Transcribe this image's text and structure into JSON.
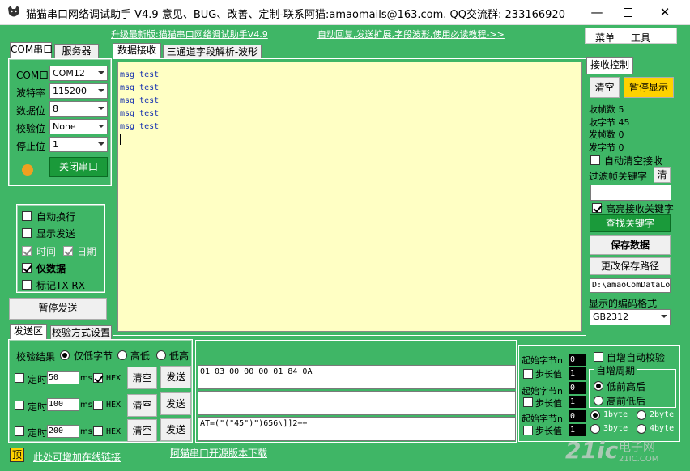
{
  "window": {
    "title": "猫猫串口网络调试助手 V4.9 意见、BUG、改善、定制-联系阿猫:amaomails@163.com. QQ交流群: 233166920"
  },
  "top_links": {
    "upgrade": "升级最新版:猫猫串口网络调试助手V4.9",
    "features": "自动回复,发送扩展,字段波形,使用必读教程->>"
  },
  "menu": {
    "items": [
      "菜单",
      "工具"
    ]
  },
  "left": {
    "tabs": [
      "COM串口",
      "服务器"
    ],
    "fields": [
      {
        "label": "COM口",
        "value": "COM12"
      },
      {
        "label": "波特率",
        "value": "115200"
      },
      {
        "label": "数据位",
        "value": "8"
      },
      {
        "label": "校验位",
        "value": "None"
      },
      {
        "label": "停止位",
        "value": "1"
      }
    ],
    "close_port": "关闭串口",
    "status_color": "#f0a020",
    "options": [
      {
        "label": "自动换行",
        "checked": false
      },
      {
        "label": "显示发送",
        "checked": false
      },
      {
        "label": "时间",
        "checked": true
      },
      {
        "label": "日期",
        "checked": true
      },
      {
        "label": "仅数据",
        "checked": true
      },
      {
        "label": "标记TX RX",
        "checked": false
      }
    ],
    "pause_send": "暂停发送"
  },
  "center": {
    "tabs": [
      "数据接收",
      "三通道字段解析-波形"
    ],
    "received_lines": [
      "msg test",
      "msg test",
      "msg test",
      "msg test",
      "msg test"
    ]
  },
  "right": {
    "tab": "接收控制",
    "clear": "清空",
    "pause_display": "暂停显示",
    "stats": [
      "收帧数 5",
      "收字节 45",
      "发帧数 0",
      "发字节 0"
    ],
    "auto_clear": "自动清空接收",
    "filter_label": "过滤帧关键字",
    "filter_btn": "清",
    "highlight": "高亮接收关键字",
    "find_keyword": "查找关键字",
    "save_data": "保存数据",
    "change_path": "更改保存路径",
    "path_value": "D:\\amaoComDataLo",
    "encoding_label": "显示的编码格式",
    "encoding_value": "GB2312"
  },
  "send": {
    "tabs": [
      "发送区",
      "校验方式设置"
    ],
    "check_result": "校验结果",
    "radios": [
      "仅低字节",
      "高低",
      "低高"
    ],
    "rows": [
      {
        "timed": "定时",
        "interval": "50",
        "unit": "ms",
        "hex": "HEX",
        "clear": "清空",
        "send": "发送",
        "content": "01 03 00 00 00 01 84 0A"
      },
      {
        "timed": "定时",
        "interval": "100",
        "unit": "ms",
        "hex": "HEX",
        "clear": "清空",
        "send": "发送",
        "content": ""
      },
      {
        "timed": "定时",
        "interval": "200",
        "unit": "ms",
        "hex": "HEX",
        "clear": "清空",
        "send": "发送",
        "content": "AT=(\"(\"45\")\")656\\]]2++"
      }
    ],
    "start_byte": "起始字节n",
    "step": "步长值",
    "digit": "0",
    "digit_step": "1",
    "auto_increment": "自增自动校验",
    "period_title": "自增周期",
    "order": [
      "低前高后",
      "高前低后"
    ],
    "bytes": [
      "1byte",
      "2byte",
      "3byte",
      "4byte"
    ]
  },
  "footer": {
    "pin": "顶",
    "add_link": "此处可增加在线链接",
    "open_source": "阿猫串口开源版本下载"
  },
  "watermark": {
    "brand": "21ic",
    "cn": "电子网",
    "domain": "21IC.COM"
  }
}
